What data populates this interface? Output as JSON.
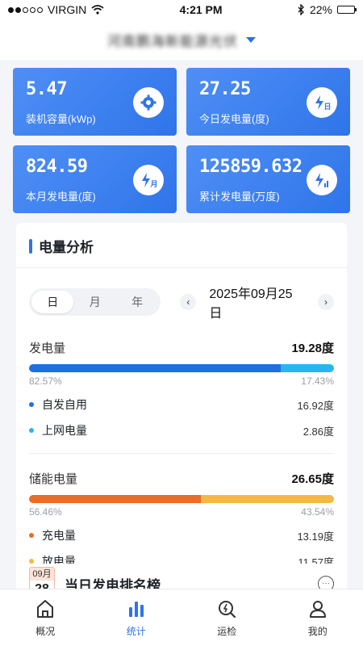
{
  "status": {
    "carrier": "VIRGIN",
    "time": "4:21 PM",
    "battery": "22%",
    "battery_level": 0.22
  },
  "header": {
    "station": "河南鹏海新能源光伏"
  },
  "cards": [
    {
      "value": "5.47",
      "label": "装机容量(kWp)",
      "icon": "gear-icon"
    },
    {
      "value": "27.25",
      "label": "今日发电量(度)",
      "icon": "lightning-day-icon",
      "icon_text": "日"
    },
    {
      "value": "824.59",
      "label": "本月发电量(度)",
      "icon": "lightning-month-icon",
      "icon_text": "月"
    },
    {
      "value": "125859.632",
      "label": "累计发电量(万度)",
      "icon": "lightning-total-icon"
    }
  ],
  "analysis": {
    "title": "电量分析",
    "segments": [
      "日",
      "月",
      "年"
    ],
    "active_segment": 0,
    "prev": "‹",
    "next": "›",
    "date": "2025年09月25日",
    "generation": {
      "title": "发电量",
      "total": "19.28度",
      "split": [
        0.8257,
        0.1743
      ],
      "pct_left": "82.57%",
      "pct_right": "17.43%",
      "items": [
        {
          "label": "自发自用",
          "value": "16.92度",
          "color": "#1f6fe0"
        },
        {
          "label": "上网电量",
          "value": "2.86度",
          "color": "#27b6f2"
        }
      ],
      "colors": [
        "#1f6fe0",
        "#27b6f2"
      ]
    },
    "storage": {
      "title": "储能电量",
      "total": "26.65度",
      "split": [
        0.5646,
        0.4354
      ],
      "pct_left": "56.46%",
      "pct_right": "43.54%",
      "items": [
        {
          "label": "充电量",
          "value": "13.19度",
          "color": "#ee6b23"
        },
        {
          "label": "放电量",
          "value": "11.57度",
          "color": "#f7b83f"
        }
      ],
      "colors": [
        "#ee6b23",
        "#f7b83f"
      ]
    }
  },
  "ranking": {
    "cal_month": "09月",
    "cal_day": "28",
    "title": "当日发电排名榜",
    "more": "···"
  },
  "tabs": [
    {
      "label": "概况",
      "icon": "home-icon"
    },
    {
      "label": "统计",
      "icon": "bar-chart-icon"
    },
    {
      "label": "运检",
      "icon": "inspection-icon"
    },
    {
      "label": "我的",
      "icon": "user-icon"
    }
  ],
  "active_tab": 1,
  "accent": "#2f74ea"
}
